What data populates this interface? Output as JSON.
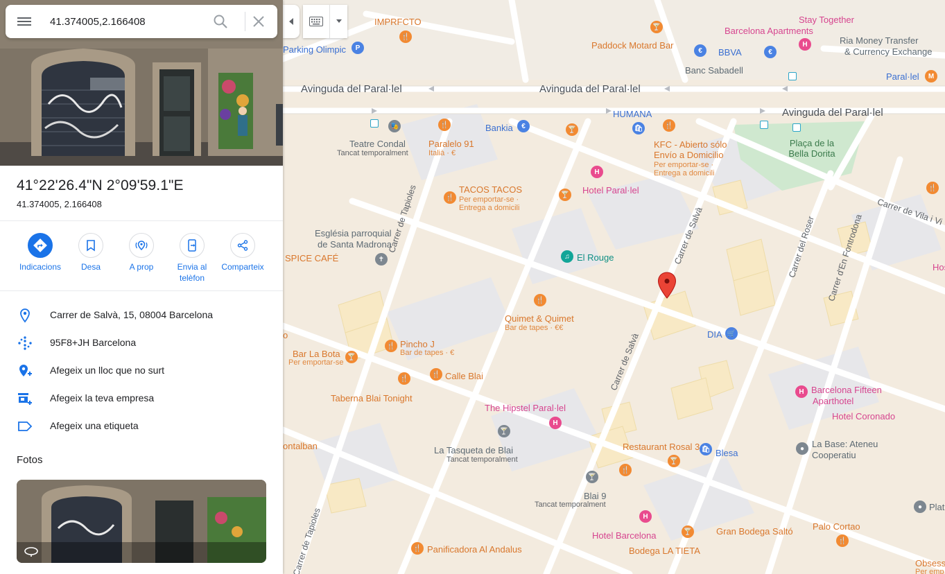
{
  "search": {
    "value": "41.374005,2.166408"
  },
  "place": {
    "title": "41°22'26.4\"N 2°09'59.1\"E",
    "subtitle": "41.374005, 2.166408"
  },
  "actions": [
    {
      "label": "Indicacions",
      "icon": "directions-icon"
    },
    {
      "label": "Desa",
      "icon": "bookmark-icon"
    },
    {
      "label": "A prop",
      "icon": "nearby-icon"
    },
    {
      "label": "Envia al telèfon",
      "icon": "send-to-phone-icon"
    },
    {
      "label": "Comparteix",
      "icon": "share-icon"
    }
  ],
  "info": [
    {
      "text": "Carrer de Salvà, 15, 08004 Barcelona",
      "icon": "location-pin-icon"
    },
    {
      "text": "95F8+JH Barcelona",
      "icon": "plus-code-icon"
    },
    {
      "text": "Afegeix un lloc que no surt",
      "icon": "add-place-icon"
    },
    {
      "text": "Afegeix la teva empresa",
      "icon": "add-business-icon"
    },
    {
      "text": "Afegeix una etiqueta",
      "icon": "label-icon"
    }
  ],
  "fotos_heading": "Fotos",
  "colors": {
    "accent": "#1a73e8",
    "marker": "#ea4335",
    "food": "#d9772c",
    "hotel": "#d6458f",
    "shop": "#3a6fd1"
  },
  "map": {
    "avenues": [
      "Avinguda del Paral·lel",
      "Avinguda del Paral·lel",
      "Avinguda del Paral·lel"
    ],
    "streets": [
      "Carrer de Tapioles",
      "Carrer de Salvà",
      "Carrer de Salvà",
      "Carrer del Roser",
      "Carrer d'En Fontrodona",
      "Carrer de Vila i Vi",
      "Carrer de Tapioles"
    ],
    "park": "Plaça de la Bella Dorita",
    "labels": {
      "imprfcto": "IMPRFCTO",
      "stay_together": "Stay Together",
      "barcelona_apartments": "Barcelona Apartments",
      "ria_money": "Ria Money Transfer",
      "currency_exchange": "& Currency Exchange",
      "parking": "Parking Olimpic",
      "paddock": "Paddock Motard Bar",
      "bbva": "BBVA",
      "banc_sabadell": "Banc Sabadell",
      "paralel_metro": "Paral·lel",
      "humana": "HUMANA",
      "bankia": "Bankia",
      "teatre": "Teatre Condal",
      "teatre_sub": "Tancat temporalment",
      "paralelo91": "Paralelo 91",
      "paralelo91_sub": "Italià · €",
      "kfc1": "KFC - Abierto sólo",
      "kfc2": "Envío a Domicilio",
      "kfc_sub1": "Per emportar-se ·",
      "kfc_sub2": "Entrega a domicili",
      "hotel_paralel": "Hotel Paral·lel",
      "tacos": "TACOS TACOS",
      "tacos_sub1": "Per emportar-se ·",
      "tacos_sub2": "Entrega a domicili",
      "esglesia1": "Església parroquial",
      "esglesia2": "de Santa Madrona",
      "spice": "SPICE CAFÉ",
      "el_rouge": "El Rouge",
      "hostal": "Host",
      "quimet": "Quimet & Quimet",
      "quimet_sub": "Bar de tapes · €€",
      "dia": "DIA",
      "pincho": "Pincho J",
      "pincho_sub": "Bar de tapes · €",
      "bar_bota": "Bar La Bota",
      "bar_bota_sub": "Per emportar-se",
      "calle_blai": "Calle Blai",
      "taberna": "Taberna Blai Tonight",
      "hipstel": "The Hipstel Paral·lel",
      "fifteen1": "Barcelona Fifteen",
      "fifteen2": "Aparthotel",
      "coronado": "Hotel Coronado",
      "montalban": "ontalban",
      "tasqueta": "La Tasqueta de Blai",
      "tasqueta_sub": "Tancat temporalment",
      "rosal": "Restaurant Rosal 34",
      "blesa": "Blesa",
      "la_base1": "La Base: Ateneu",
      "la_base2": "Cooperatiu",
      "plat": "Plat",
      "blai9": "Blai 9",
      "blai9_sub": "Tancat temporalment",
      "hotel_bcn": "Hotel Barcelona",
      "gran_bodega": "Gran Bodega Saltó",
      "palo_cortao": "Palo Cortao",
      "panificadora": "Panificadora Al Andalus",
      "bodega_tieta": "Bodega LA TIETA",
      "obsessio": "Obsessio",
      "obsessio_sub": "Per emp",
      "edge_o": "o"
    }
  }
}
